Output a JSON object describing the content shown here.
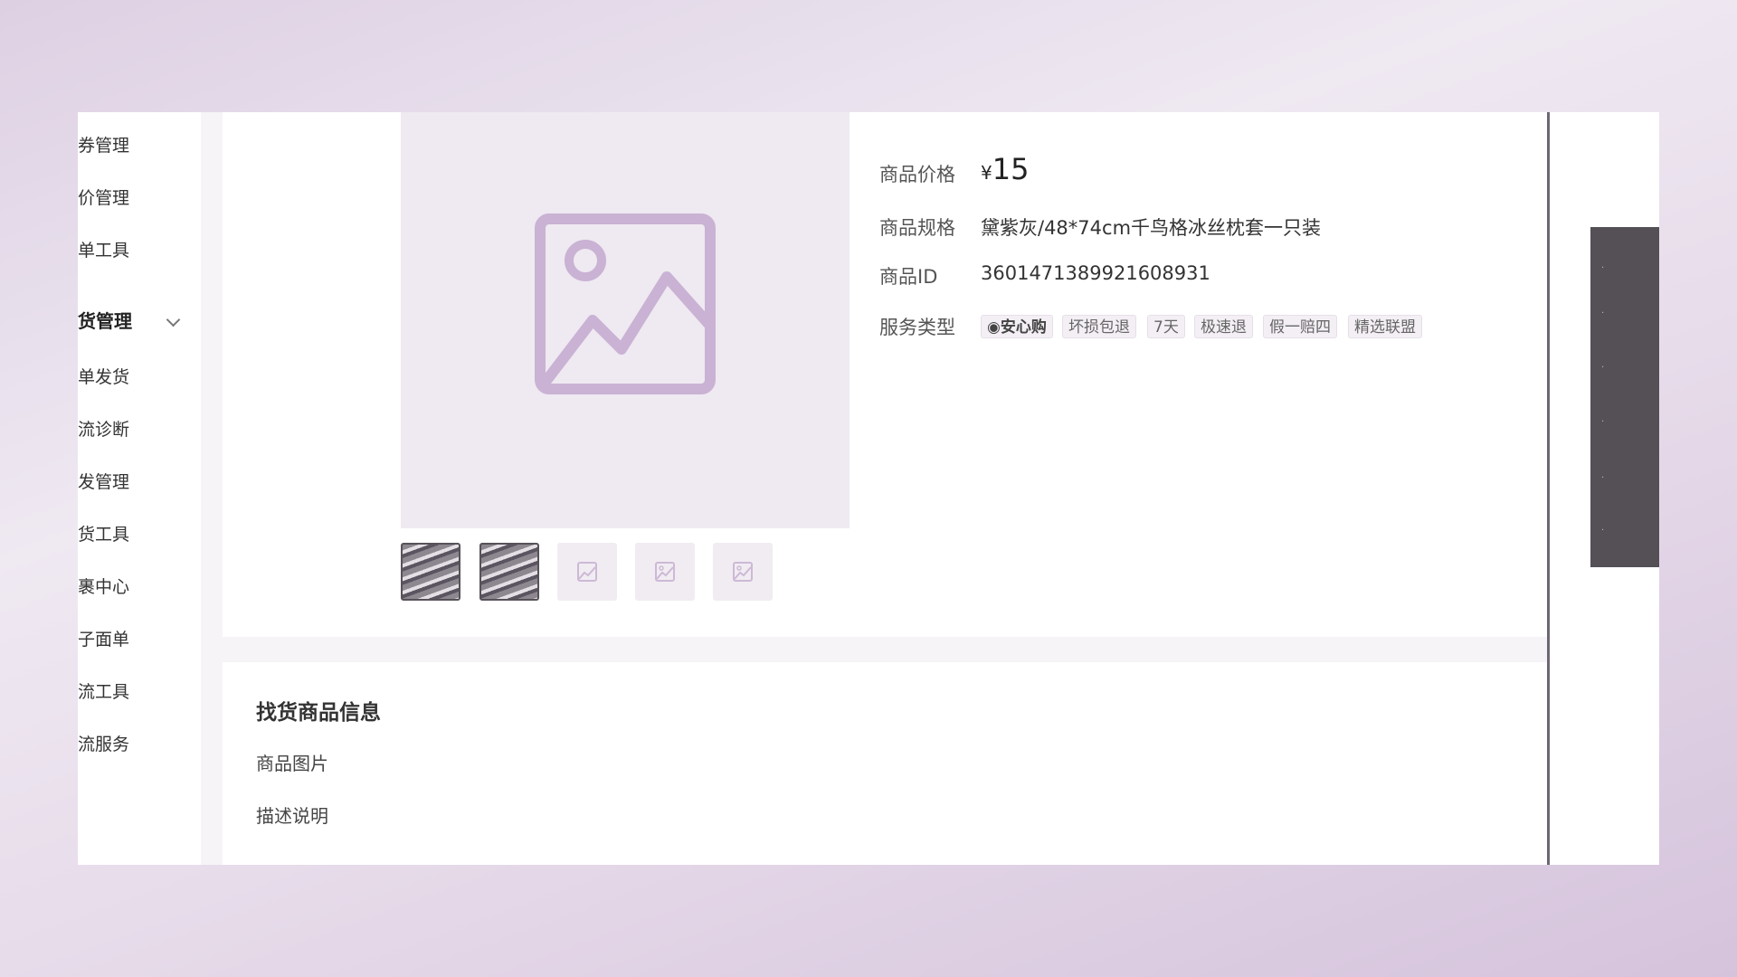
{
  "sidebar": {
    "items": [
      {
        "label": "券管理"
      },
      {
        "label": "价管理"
      },
      {
        "label": "单工具"
      },
      {
        "label": "货管理"
      },
      {
        "label": "单发货"
      },
      {
        "label": "流诊断"
      },
      {
        "label": "发管理"
      },
      {
        "label": "货工具"
      },
      {
        "label": "裹中心"
      },
      {
        "label": "子面单"
      },
      {
        "label": "流工具"
      },
      {
        "label": "流服务"
      }
    ]
  },
  "product": {
    "price_label": "商品价格",
    "price_currency": "¥",
    "price_value": "15",
    "spec_label": "商品规格",
    "spec_value": "黛紫灰/48*74cm千鸟格冰丝枕套一只装",
    "id_label": "商品ID",
    "id_value": "3601471389921608931",
    "service_label": "服务类型",
    "service_tags": [
      "安心购",
      "坏损包退",
      "7天",
      "极速退",
      "假一赔四",
      "精选联盟"
    ]
  },
  "find_section": {
    "title": "找货商品信息",
    "image_label": "商品图片",
    "desc_label": "描述说明"
  },
  "colors": {
    "accent": "#c9b2d4",
    "screen_bg": "#f6f4f7"
  },
  "icons": {
    "main_placeholder": "image-placeholder-icon",
    "thumb_placeholder": "image-placeholder-icon",
    "group_toggle": "chevron-down-icon"
  }
}
